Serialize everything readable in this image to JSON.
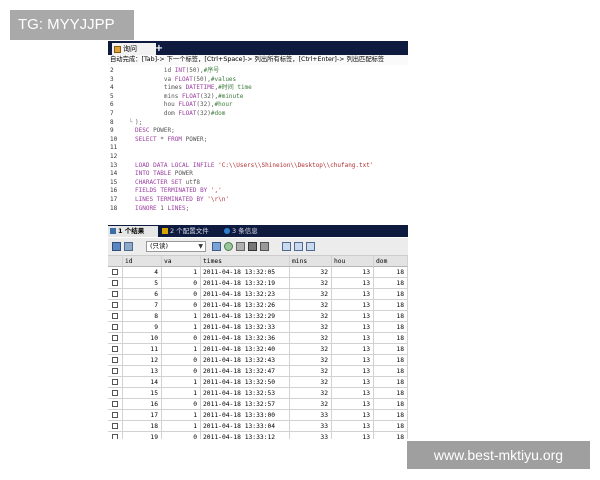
{
  "overlay": {
    "tag": "TG: MYYJJPP",
    "watermark": "www.best-mktiyu.org"
  },
  "tabs": {
    "query_label": "询问",
    "add_icon": "plus-icon"
  },
  "hint_bar": "自动完成：[Tab]-> 下一个标签，[Ctrl+Space]-> 列出所有标签，[Ctrl+Enter]-> 列出匹配标签",
  "editor": {
    "lines": [
      {
        "num": "2",
        "fold": "",
        "code": "        id INT(50),#序号"
      },
      {
        "num": "3",
        "fold": "",
        "code": "        va FLOAT(50),#values"
      },
      {
        "num": "4",
        "fold": "",
        "code": "        times DATETIME,#时间 time"
      },
      {
        "num": "5",
        "fold": "",
        "code": "        mins FLOAT(32),#minute"
      },
      {
        "num": "6",
        "fold": "",
        "code": "        hou FLOAT(32),#hour"
      },
      {
        "num": "7",
        "fold": "",
        "code": "        dom FLOAT(32)#dom"
      },
      {
        "num": "8",
        "fold": "└",
        "code": ");"
      },
      {
        "num": "9",
        "fold": "",
        "code": "DESC POWER;"
      },
      {
        "num": "10",
        "fold": "",
        "code": "SELECT * FROM POWER;"
      },
      {
        "num": "11",
        "fold": "",
        "code": ""
      },
      {
        "num": "12",
        "fold": "",
        "code": ""
      },
      {
        "num": "13",
        "fold": "",
        "code": "LOAD DATA LOCAL INFILE 'C:\\\\Users\\\\Shineion\\\\Desktop\\\\chufang.txt'"
      },
      {
        "num": "14",
        "fold": "",
        "code": "INTO TABLE POWER"
      },
      {
        "num": "15",
        "fold": "",
        "code": "CHARACTER SET utf8"
      },
      {
        "num": "16",
        "fold": "",
        "code": "FIELDS TERMINATED BY ','"
      },
      {
        "num": "17",
        "fold": "",
        "code": "LINES TERMINATED BY '\\r\\n'"
      },
      {
        "num": "18",
        "fold": "",
        "code": "IGNORE 1 LINES;"
      }
    ]
  },
  "result_tabs": [
    {
      "label": "1 个结果",
      "icon": "grid-icon",
      "color": "#3a6ea5"
    },
    {
      "label": "2 个配置文件",
      "icon": "profile-icon",
      "color": "#d9a400"
    },
    {
      "label": "3 条信息",
      "icon": "info-icon",
      "color": "#2f7fd0"
    }
  ],
  "toolbar": {
    "mode_select": "(只读)"
  },
  "table": {
    "columns": [
      "id",
      "va",
      "times",
      "mins",
      "hou",
      "dom"
    ],
    "rows": [
      [
        "4",
        "1",
        "2011-04-18 13:32:05",
        "32",
        "13",
        "18"
      ],
      [
        "5",
        "0",
        "2011-04-18 13:32:19",
        "32",
        "13",
        "18"
      ],
      [
        "6",
        "0",
        "2011-04-18 13:32:23",
        "32",
        "13",
        "18"
      ],
      [
        "7",
        "0",
        "2011-04-18 13:32:26",
        "32",
        "13",
        "18"
      ],
      [
        "8",
        "1",
        "2011-04-18 13:32:29",
        "32",
        "13",
        "18"
      ],
      [
        "9",
        "1",
        "2011-04-18 13:32:33",
        "32",
        "13",
        "18"
      ],
      [
        "10",
        "0",
        "2011-04-18 13:32:36",
        "32",
        "13",
        "18"
      ],
      [
        "11",
        "1",
        "2011-04-18 13:32:40",
        "32",
        "13",
        "18"
      ],
      [
        "12",
        "0",
        "2011-04-18 13:32:43",
        "32",
        "13",
        "18"
      ],
      [
        "13",
        "0",
        "2011-04-18 13:32:47",
        "32",
        "13",
        "18"
      ],
      [
        "14",
        "1",
        "2011-04-18 13:32:50",
        "32",
        "13",
        "18"
      ],
      [
        "15",
        "1",
        "2011-04-18 13:32:53",
        "32",
        "13",
        "18"
      ],
      [
        "16",
        "0",
        "2011-04-18 13:32:57",
        "32",
        "13",
        "18"
      ],
      [
        "17",
        "1",
        "2011-04-18 13:33:00",
        "33",
        "13",
        "18"
      ],
      [
        "18",
        "1",
        "2011-04-18 13:33:04",
        "33",
        "13",
        "18"
      ],
      [
        "19",
        "0",
        "2011-04-18 13:33:12",
        "33",
        "13",
        "18"
      ]
    ]
  }
}
